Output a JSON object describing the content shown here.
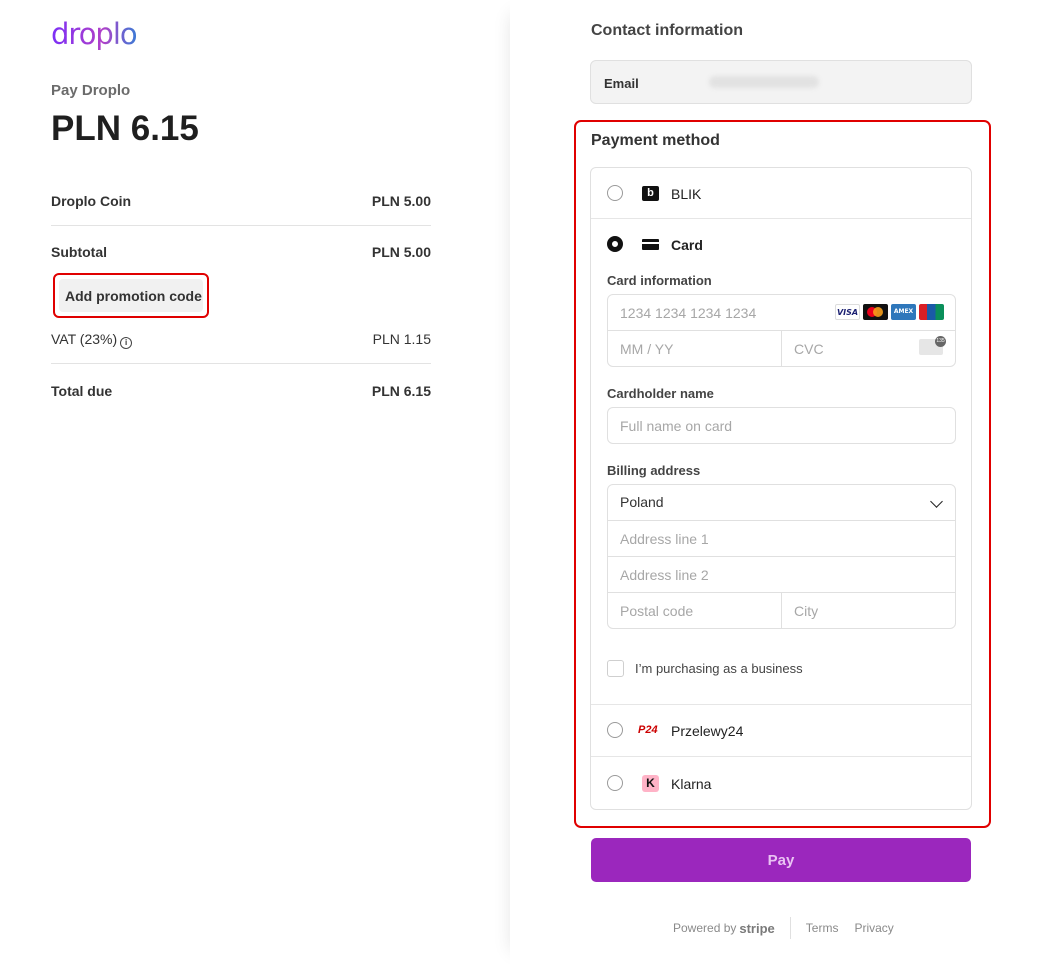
{
  "brand": {
    "logo_text": "droplo"
  },
  "summary": {
    "pay_label": "Pay Droplo",
    "amount": "PLN 6.15",
    "item_name": "Droplo Coin",
    "item_price": "PLN 5.00",
    "subtotal_label": "Subtotal",
    "subtotal_value": "PLN 5.00",
    "promo_button": "Add promotion code",
    "vat_label": "VAT (23%)",
    "vat_value": "PLN 1.15",
    "total_label": "Total due",
    "total_value": "PLN 6.15"
  },
  "contact": {
    "title": "Contact information",
    "email_label": "Email"
  },
  "payment": {
    "title": "Payment method",
    "methods": [
      {
        "label": "BLIK",
        "icon": "blik-icon",
        "selected": false
      },
      {
        "label": "Card",
        "icon": "card-icon",
        "selected": true
      },
      {
        "label": "Przelewy24",
        "icon": "p24-icon",
        "selected": false
      },
      {
        "label": "Klarna",
        "icon": "klarna-icon",
        "selected": false
      }
    ],
    "icon_glyphs": {
      "blik": "b",
      "p24": "P24",
      "klarna": "K"
    },
    "card_info_label": "Card information",
    "card_number_placeholder": "1234 1234 1234 1234",
    "expiry_placeholder": "MM / YY",
    "cvc_placeholder": "CVC",
    "card_brands": [
      "VISA",
      "mastercard",
      "AMEX",
      "UnionPay"
    ],
    "cardholder_label": "Cardholder name",
    "cardholder_placeholder": "Full name on card",
    "billing_label": "Billing address",
    "country_value": "Poland",
    "address1_placeholder": "Address line 1",
    "address2_placeholder": "Address line 2",
    "postal_placeholder": "Postal code",
    "city_placeholder": "City",
    "business_checkbox_label": "I’m purchasing as a business"
  },
  "pay_button": "Pay",
  "footer": {
    "powered_by": "Powered by",
    "stripe": "stripe",
    "terms": "Terms",
    "privacy": "Privacy"
  },
  "colors": {
    "accent": "#9b27bd",
    "highlight": "#e00000"
  }
}
